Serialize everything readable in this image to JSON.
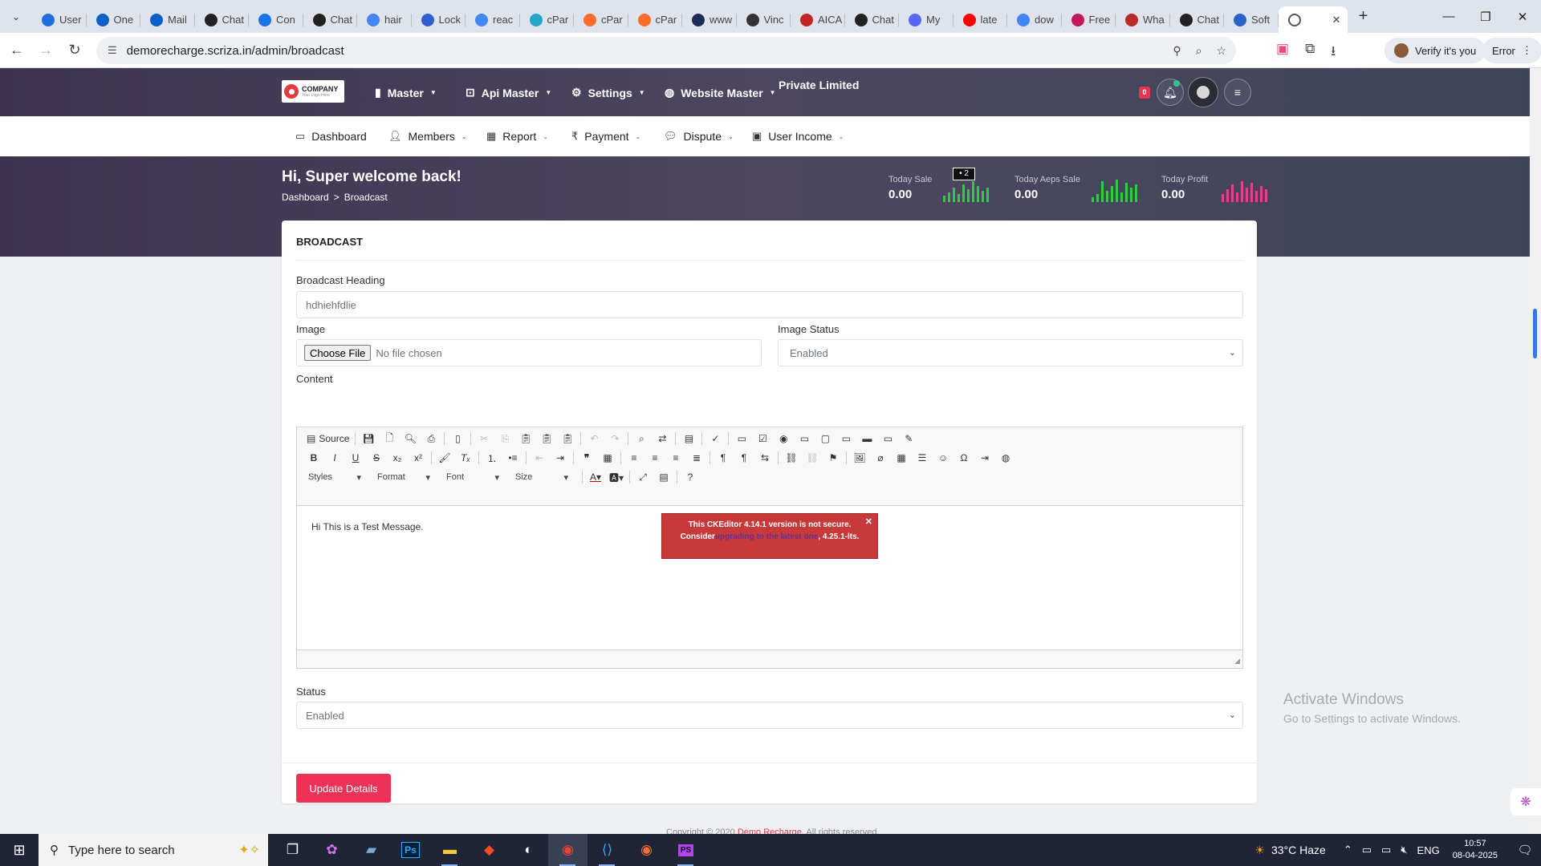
{
  "browser": {
    "tabs": [
      {
        "label": "User",
        "color": "#1e6fd9"
      },
      {
        "label": "One",
        "color": "#0a62c8"
      },
      {
        "label": "Mail",
        "color": "#0a62c8"
      },
      {
        "label": "Chat",
        "color": "#222222"
      },
      {
        "label": "Con",
        "color": "#1a73e8"
      },
      {
        "label": "Chat",
        "color": "#222222"
      },
      {
        "label": "hair",
        "color": "#4285f4"
      },
      {
        "label": "Lock",
        "color": "#2f5fd0"
      },
      {
        "label": "reac",
        "color": "#4285f4"
      },
      {
        "label": "cPar",
        "color": "#22a6c9"
      },
      {
        "label": "cPar",
        "color": "#ff6c2c"
      },
      {
        "label": "cPar",
        "color": "#ff6c2c"
      },
      {
        "label": "www",
        "color": "#1b2d57"
      },
      {
        "label": "Vinc",
        "color": "#333333"
      },
      {
        "label": "AICA",
        "color": "#c42424"
      },
      {
        "label": "Chat",
        "color": "#222222"
      },
      {
        "label": "My",
        "color": "#5865f2"
      },
      {
        "label": "late",
        "color": "#ff0000"
      },
      {
        "label": "dow",
        "color": "#4285f4"
      },
      {
        "label": "Free",
        "color": "#c2185b"
      },
      {
        "label": "Wha",
        "color": "#b92b27"
      },
      {
        "label": "Chat",
        "color": "#222222"
      },
      {
        "label": "Soft",
        "color": "#2b62c9"
      }
    ],
    "url": "demorecharge.scriza.in/admin/broadcast",
    "verify_label": "Verify it's you",
    "error_label": "Error"
  },
  "app": {
    "logo_text": "COMPANY",
    "logo_sub": "Your Logo Here",
    "topnav": [
      {
        "label": "Master",
        "icon": "book-icon"
      },
      {
        "label": "Api Master",
        "icon": "briefcase-icon"
      },
      {
        "label": "Settings",
        "icon": "gear-icon"
      },
      {
        "label": "Website Master",
        "icon": "globe-icon"
      }
    ],
    "brand": "Private Limited",
    "notif_count": "0",
    "menubar": [
      {
        "label": "Dashboard",
        "icon": "monitor-icon"
      },
      {
        "label": "Members",
        "icon": "users-icon"
      },
      {
        "label": "Report",
        "icon": "table-icon"
      },
      {
        "label": "Payment",
        "icon": "rupee-icon"
      },
      {
        "label": "Dispute",
        "icon": "comments-icon"
      },
      {
        "label": "User Income",
        "icon": "money-icon"
      }
    ],
    "greeting": "Hi, Super welcome back!",
    "breadcrumb": {
      "home": "Dashboard",
      "sep": ">",
      "current": "Broadcast"
    },
    "stats": [
      {
        "label": "Today Sale",
        "value": "0.00",
        "color": "#2ecc40"
      },
      {
        "label": "Today Aeps Sale",
        "value": "0.00",
        "color": "#2ecc40"
      },
      {
        "label": "Today Profit",
        "value": "0.00",
        "color": "#e83e8c"
      }
    ],
    "tooltip": "• 2"
  },
  "form": {
    "title": "BROADCAST",
    "heading_label": "Broadcast Heading",
    "heading_value": "hdhiehfdlie",
    "image_label": "Image",
    "file_button": "Choose File",
    "file_status": "No file chosen",
    "image_status_label": "Image Status",
    "image_status_value": "Enabled",
    "content_label": "Content",
    "status_label": "Status",
    "status_value": "Enabled",
    "submit": "Update Details"
  },
  "editor": {
    "source_label": "Source",
    "styles": "Styles",
    "format": "Format",
    "font": "Font",
    "size": "Size",
    "body_text": "Hi This is a Test Message.",
    "warning_pre": "This CKEditor 4.14.1 version is not secure. Consider",
    "warning_link": "upgrading to the latest one",
    "warning_post": ", 4.25.1-lts."
  },
  "footer_text": "Copyright © 2020",
  "footer_brand": "Demo Recharge",
  "footer_rest": ". All rights reserved.",
  "watermark": {
    "line1": "Activate Windows",
    "line2": "Go to Settings to activate Windows."
  },
  "taskbar": {
    "search_placeholder": "Type here to search",
    "weather": "33°C  Haze",
    "lang": "ENG",
    "time": "10:57",
    "date": "08-04-2025"
  }
}
